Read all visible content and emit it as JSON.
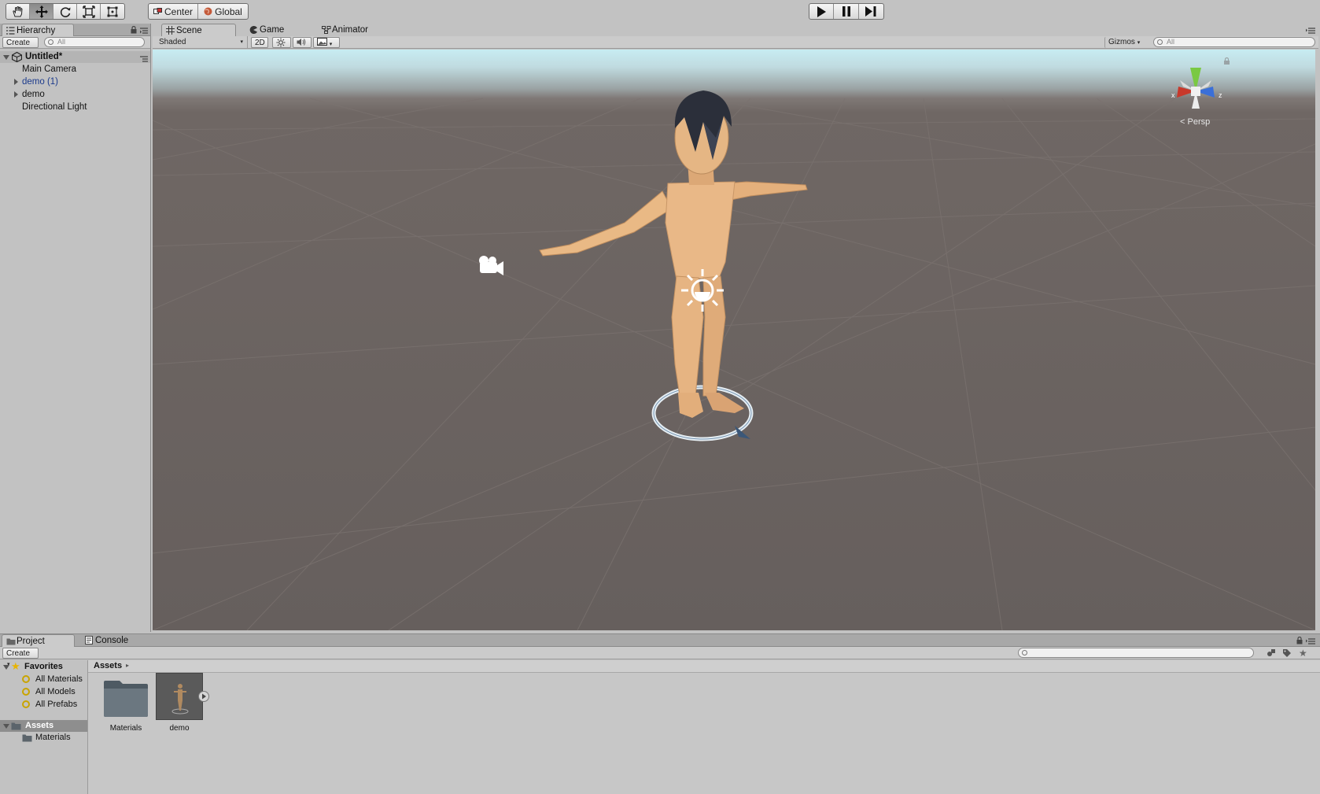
{
  "toolbar": {
    "tools": [
      {
        "name": "hand-tool",
        "active": false
      },
      {
        "name": "move-tool",
        "active": true
      },
      {
        "name": "rotate-tool",
        "active": false
      },
      {
        "name": "scale-tool",
        "active": false
      },
      {
        "name": "rect-tool",
        "active": false
      }
    ],
    "pivot_label": "Center",
    "space_label": "Global",
    "play_icons": [
      "play-icon",
      "pause-icon",
      "step-icon"
    ]
  },
  "hierarchy": {
    "tab_label": "Hierarchy",
    "create_label": "Create",
    "search_placeholder": "All",
    "scene_name": "Untitled*",
    "items": [
      {
        "label": "Main Camera",
        "expandable": false,
        "color": "#111111"
      },
      {
        "label": "demo (1)",
        "expandable": true,
        "color": "#1b3a8c"
      },
      {
        "label": "demo",
        "expandable": true,
        "color": "#111111"
      },
      {
        "label": "Directional Light",
        "expandable": false,
        "color": "#111111"
      }
    ]
  },
  "scene": {
    "tabs": [
      {
        "label": "Scene",
        "icon": "grid-icon",
        "active": true
      },
      {
        "label": "Game",
        "icon": "pacman-icon",
        "active": false
      },
      {
        "label": "Animator",
        "icon": "animator-icon",
        "active": false
      }
    ],
    "shading_mode": "Shaded",
    "mode_2d_label": "2D",
    "gizmos_label": "Gizmos",
    "search_placeholder": "All",
    "projection_label": "Persp",
    "axis_x": "x",
    "axis_z": "z",
    "colors": {
      "x_axis": "#c8382b",
      "y_axis": "#7ac943",
      "z_axis": "#3a6fd8",
      "skin": "#e7b583",
      "floor": "#6a6360"
    }
  },
  "project": {
    "tabs": [
      {
        "label": "Project",
        "icon": "folder-icon",
        "active": true
      },
      {
        "label": "Console",
        "icon": "console-icon",
        "active": false
      }
    ],
    "create_label": "Create",
    "favorites_label": "Favorites",
    "favorites": [
      "All Materials",
      "All Models",
      "All Prefabs"
    ],
    "assets_label": "Assets",
    "asset_folders": [
      "Materials"
    ],
    "breadcrumb": "Assets",
    "assets": [
      {
        "label": "Materials",
        "icon": "folder-icon"
      },
      {
        "label": "demo",
        "icon": "model-icon"
      }
    ]
  }
}
